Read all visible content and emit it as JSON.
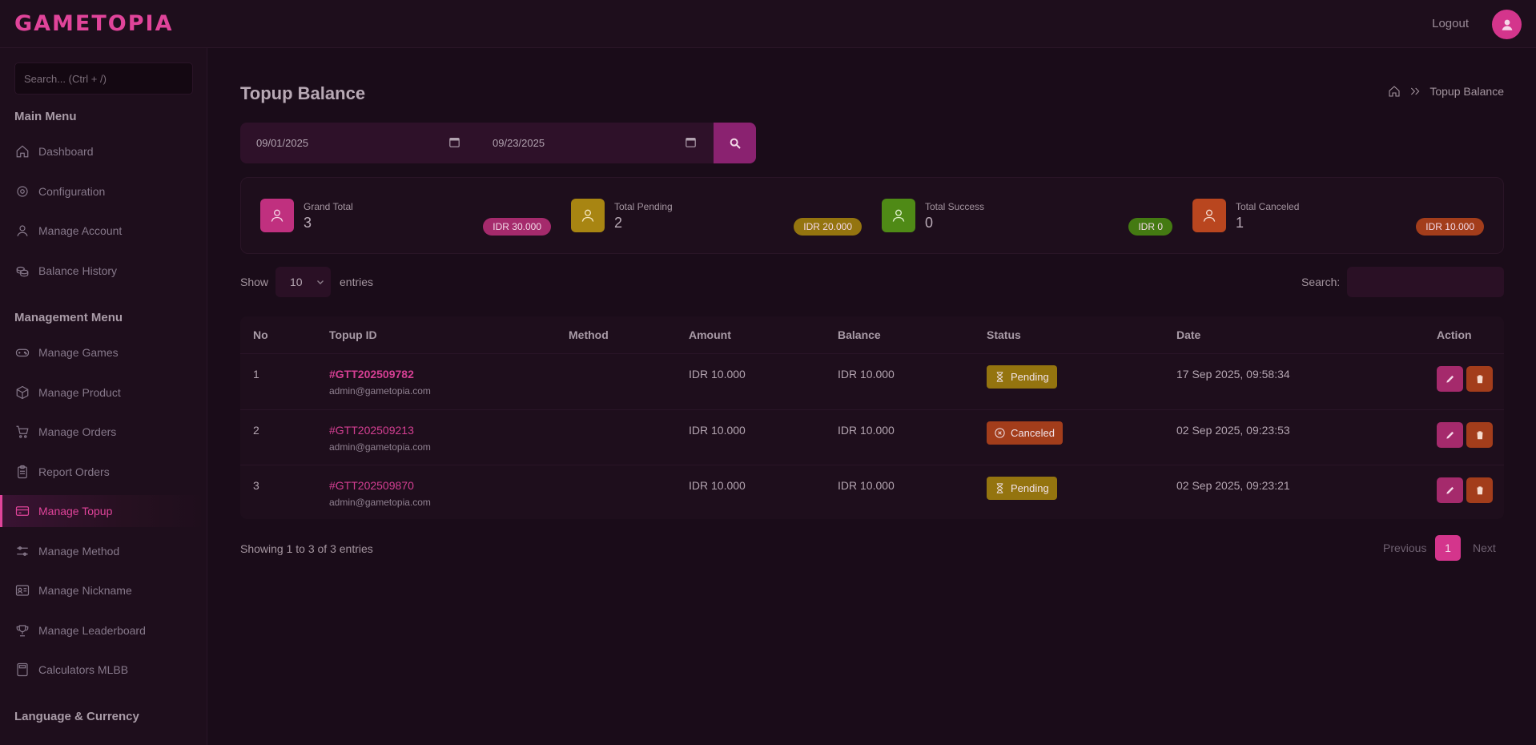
{
  "brand": {
    "name": "GAMETOPIA"
  },
  "topbar": {
    "logout_label": "Logout"
  },
  "sidebar": {
    "search_placeholder": "Search... (Ctrl + /)",
    "sections": [
      {
        "heading": "Main Menu"
      },
      {
        "heading": "Management Menu"
      },
      {
        "heading": "Language & Currency"
      }
    ],
    "items": [
      {
        "label": "Dashboard",
        "icon": "home-icon"
      },
      {
        "label": "Configuration",
        "icon": "gear-icon"
      },
      {
        "label": "Manage Account",
        "icon": "user-icon"
      },
      {
        "label": "Balance History",
        "icon": "coins-icon"
      },
      {
        "label": "Manage Games",
        "icon": "gamepad-icon"
      },
      {
        "label": "Manage Product",
        "icon": "box-icon"
      },
      {
        "label": "Manage Orders",
        "icon": "cart-icon"
      },
      {
        "label": "Report Orders",
        "icon": "clipboard-icon"
      },
      {
        "label": "Manage Topup",
        "icon": "wallet-icon",
        "active": true
      },
      {
        "label": "Manage Method",
        "icon": "sliders-icon"
      },
      {
        "label": "Manage Nickname",
        "icon": "id-card-icon"
      },
      {
        "label": "Manage Leaderboard",
        "icon": "trophy-icon"
      },
      {
        "label": "Calculators MLBB",
        "icon": "calculator-icon"
      }
    ]
  },
  "page": {
    "title": "Topup Balance",
    "breadcrumb": {
      "current": "Topup Balance"
    }
  },
  "filter": {
    "start_date": "09/01/2025",
    "end_date": "09/23/2025"
  },
  "stats": [
    {
      "label": "Grand Total",
      "value": "3",
      "badge": "IDR 30.000",
      "color": "#c0307f"
    },
    {
      "label": "Total Pending",
      "value": "2",
      "badge": "IDR 20.000",
      "color": "#a88512"
    },
    {
      "label": "Total Success",
      "value": "0",
      "badge": "IDR 0",
      "color": "#4f8a16"
    },
    {
      "label": "Total Canceled",
      "value": "1",
      "badge": "IDR 10.000",
      "color": "#b9461f"
    }
  ],
  "table_controls": {
    "show_label": "Show",
    "page_size": "10",
    "entries_label": "entries",
    "search_label": "Search:"
  },
  "table": {
    "columns": [
      "No",
      "Topup ID",
      "Method",
      "Amount",
      "Balance",
      "Status",
      "Date",
      "Action"
    ],
    "rows": [
      {
        "no": "1",
        "topup_id": "#GTT202509782",
        "email": "admin@gametopia.com",
        "method": "",
        "amount": "IDR 10.000",
        "balance": "IDR 10.000",
        "status": "Pending",
        "date": "17 Sep 2025, 09:58:34"
      },
      {
        "no": "2",
        "topup_id": "#GTT202509213",
        "email": "admin@gametopia.com",
        "method": "",
        "amount": "IDR 10.000",
        "balance": "IDR 10.000",
        "status": "Canceled",
        "date": "02 Sep 2025, 09:23:53"
      },
      {
        "no": "3",
        "topup_id": "#GTT202509870",
        "email": "admin@gametopia.com",
        "method": "",
        "amount": "IDR 10.000",
        "balance": "IDR 10.000",
        "status": "Pending",
        "date": "02 Sep 2025, 09:23:21"
      }
    ]
  },
  "footer": {
    "showing": "Showing 1 to 3 of 3 entries",
    "previous": "Previous",
    "current_page": "1",
    "next": "Next"
  },
  "colors": {
    "accent": "#d4358c",
    "pending": "#a88512",
    "canceled": "#b9461f"
  }
}
